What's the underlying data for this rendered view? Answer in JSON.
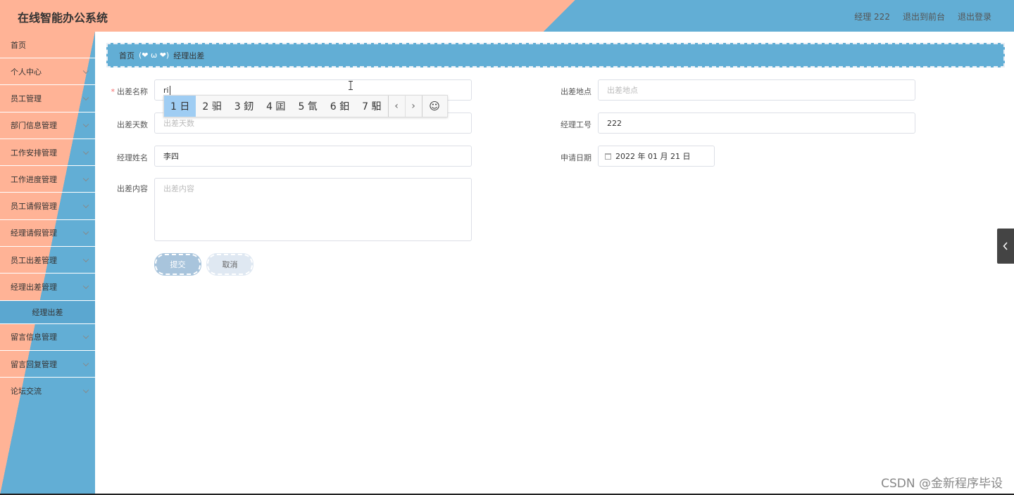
{
  "app": {
    "title": "在线智能办公系统"
  },
  "header": {
    "user_label": "经理 222",
    "back_front_label": "退出到前台",
    "logout_label": "退出登录"
  },
  "sidebar": {
    "items": [
      {
        "label": "首页",
        "has_chevron": false
      },
      {
        "label": "个人中心",
        "has_chevron": true
      },
      {
        "label": "员工管理",
        "has_chevron": true
      },
      {
        "label": "部门信息管理",
        "has_chevron": true
      },
      {
        "label": "工作安排管理",
        "has_chevron": true
      },
      {
        "label": "工作进度管理",
        "has_chevron": true
      },
      {
        "label": "员工请假管理",
        "has_chevron": true
      },
      {
        "label": "经理请假管理",
        "has_chevron": true
      },
      {
        "label": "员工出差管理",
        "has_chevron": true
      },
      {
        "label": "经理出差管理",
        "has_chevron": true
      }
    ],
    "active_sub": "经理出差",
    "items_after": [
      {
        "label": "留言信息管理",
        "has_chevron": true
      },
      {
        "label": "留言回复管理",
        "has_chevron": true
      },
      {
        "label": "论坛交流",
        "has_chevron": true
      }
    ]
  },
  "breadcrumb": {
    "home": "首页",
    "separator": "(❤ ω ❤)",
    "current": "经理出差"
  },
  "form": {
    "trip_name": {
      "label": "出差名称",
      "value": "ri",
      "required": true
    },
    "trip_location": {
      "label": "出差地点",
      "placeholder": "出差地点"
    },
    "trip_days": {
      "label": "出差天数",
      "placeholder": "出差天数"
    },
    "manager_id": {
      "label": "经理工号",
      "value": "222"
    },
    "manager_name": {
      "label": "经理姓名",
      "value": "李四"
    },
    "apply_date": {
      "label": "申请日期",
      "value": "2022 年 01 月 21 日"
    },
    "trip_content": {
      "label": "出差内容",
      "placeholder": "出差内容"
    },
    "submit_label": "提交",
    "cancel_label": "取消"
  },
  "ime": {
    "candidates": [
      "1 日",
      "2 驲",
      "3 釰",
      "4 囸",
      "5 氜",
      "6 鈤",
      "7 馹"
    ],
    "prev": "‹",
    "next": "›",
    "emoji": "☺"
  },
  "watermark": "CSDN @金新程序毕设",
  "colors": {
    "peach": "#ffb396",
    "blue": "#62aed5",
    "active": "#5ba7d0"
  }
}
